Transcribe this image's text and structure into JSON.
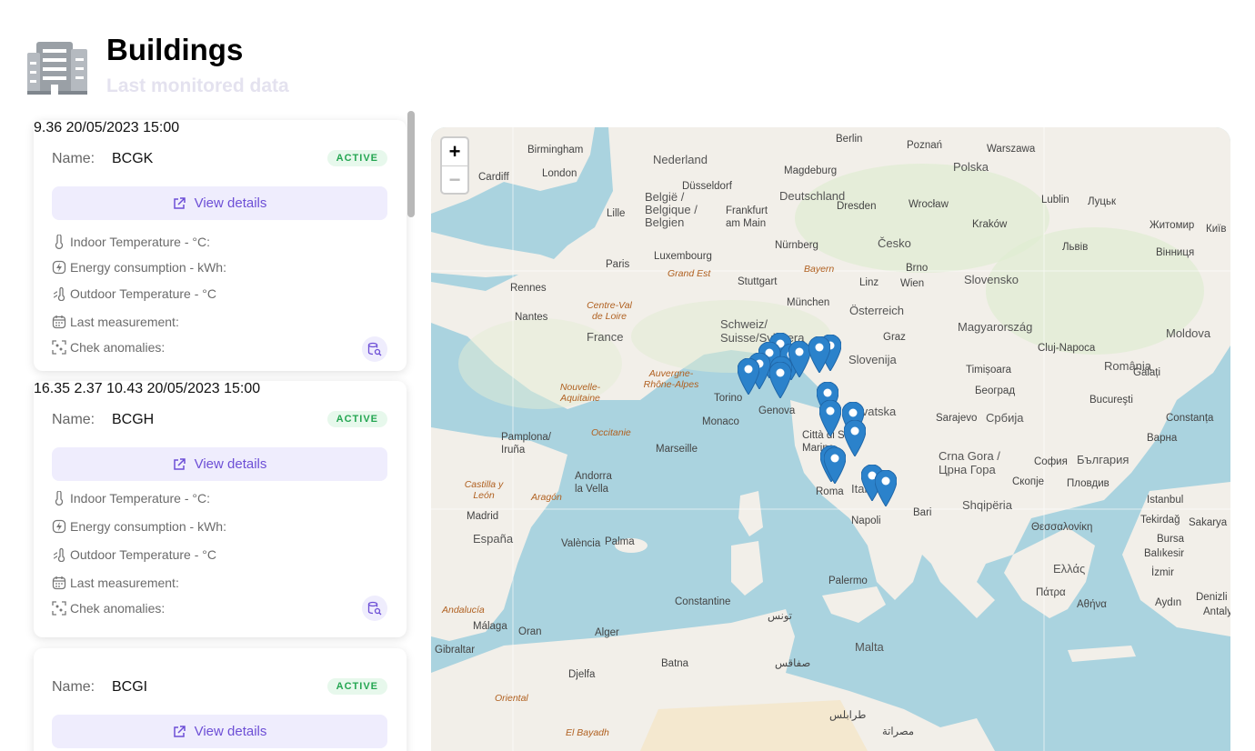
{
  "header": {
    "title": "Buildings",
    "subtitle": "Last monitored data"
  },
  "labels": {
    "name": "Name:",
    "indoor": "Indoor Temperature - °C:",
    "energy": "Energy consumption - kWh:",
    "outdoor": "Outdoor Temperature - °C",
    "last": "Last measurement:",
    "anomalies": "Chek anomalies:",
    "details_button": "View details"
  },
  "buildings": [
    {
      "name": "BCGK",
      "status": "ACTIVE",
      "indoor": "",
      "energy": "",
      "outdoor": "9.36",
      "last": "20/05/2023 15:00"
    },
    {
      "name": "BCGH",
      "status": "ACTIVE",
      "indoor": "16.35",
      "energy": "2.37",
      "outdoor": "10.43",
      "last": "20/05/2023 15:00"
    },
    {
      "name": "BCGI",
      "status": "ACTIVE"
    }
  ],
  "map": {
    "zoom_in": "+",
    "zoom_out": "−",
    "places": [
      "Birmingham",
      "London",
      "Cardiff",
      "Nederland",
      "België / Belgique / Belgien",
      "Lille",
      "Düsseldorf",
      "Frankfurt am Main",
      "Deutschland",
      "Magdeburg",
      "Berlin",
      "Poznań",
      "Warszawa",
      "Polska",
      "Dresden",
      "Wrocław",
      "Lublin",
      "Луцьк",
      "Житомир",
      "Київ",
      "Львів",
      "Вінниця",
      "Kraków",
      "Česko",
      "Nürnberg",
      "Brno",
      "Luxembourg",
      "Paris",
      "Grand Est",
      "Stuttgart",
      "Bayern",
      "Linz",
      "Wien",
      "Slovensko",
      "Rennes",
      "Nantes",
      "Centre-Val de Loire",
      "France",
      "München",
      "Österreich",
      "Magyarország",
      "Cluj-Napoca",
      "Schweiz/ Suisse/Svizzera",
      "Graz",
      "Slovenija",
      "Timișoara",
      "România",
      "Moldova",
      "Galați",
      "Auvergne-Rhône-Alpes",
      "Nouvelle-Aquitaine",
      "Torino",
      "Genova",
      "Monaco",
      "Hrvatska",
      "Београд",
      "Србија",
      "Sarajevo",
      "Bucureşti",
      "Constanța",
      "Occitanie",
      "Marseille",
      "Pamplona/ Iruña",
      "Andorra la Vella",
      "Città di San Marino",
      "Crna Gora / Црна Гора",
      "София",
      "България",
      "Варна",
      "Castilla y León",
      "Aragón",
      "Roma",
      "Italia",
      "Скопје",
      "Пловдив",
      "Shqipëria",
      "Istanbul",
      "Tekirdağ",
      "Madrid",
      "España",
      "València",
      "Palma",
      "Napoli",
      "Bari",
      "Θεσσαλονίκη",
      "Sakarya",
      "Bursa",
      "Balıkesir",
      "Ελλάς",
      "İzmir",
      "Denizli",
      "Πάτρα",
      "Αθήνα",
      "Aydın",
      "Antalya",
      "Andalucía",
      "Palermo",
      "Constantine",
      "Málaga",
      "Oran",
      "Alger",
      "تونس",
      "Malta",
      "Gibraltar",
      "Djelfa",
      "Batna",
      "صفاقس",
      "Oriental",
      "El Bayadh",
      "طرابلس",
      "مصراتة"
    ]
  }
}
